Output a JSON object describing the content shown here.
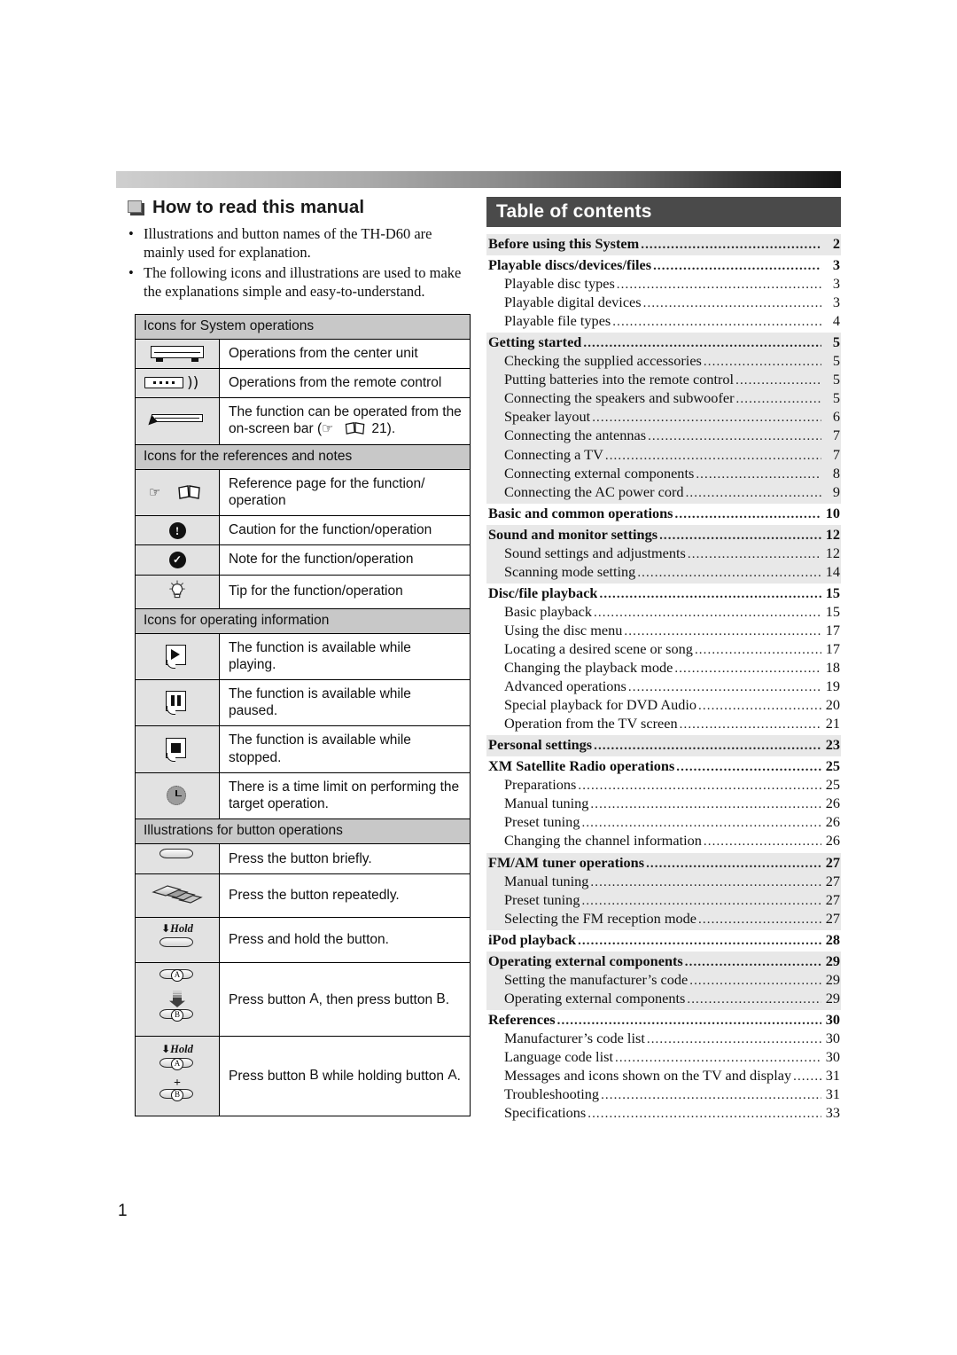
{
  "page": {
    "number": "1"
  },
  "left": {
    "heading": "How to read this manual",
    "bullets": [
      "Illustrations and button names of the TH-D60 are mainly used for explanation.",
      "The following icons and illustrations are used to make the explanations simple and easy-to-understand."
    ],
    "sections": [
      {
        "title": "Icons for System operations",
        "rows": [
          {
            "icon": "center-unit-icon",
            "text": "Operations from the center unit"
          },
          {
            "icon": "remote-control-icon",
            "text": "Operations from the remote control"
          },
          {
            "icon": "on-screen-bar-icon",
            "text": "The function can be operated from the on-screen bar (",
            "text_after": " 21).",
            "inline_ref_page": "21"
          }
        ]
      },
      {
        "title": "Icons for the references and notes",
        "rows": [
          {
            "icon": "reference-page-icon",
            "text": "Reference page for the function/ operation"
          },
          {
            "icon": "caution-icon",
            "text": "Caution for the function/operation"
          },
          {
            "icon": "note-icon",
            "text": "Note for the function/operation"
          },
          {
            "icon": "tip-bulb-icon",
            "text": "Tip for the function/operation"
          }
        ]
      },
      {
        "title": "Icons for operating information",
        "rows": [
          {
            "icon": "play-state-icon",
            "text": "The function is available while playing."
          },
          {
            "icon": "pause-state-icon",
            "text": "The function is available while paused."
          },
          {
            "icon": "stop-state-icon",
            "text": "The function is available while stopped."
          },
          {
            "icon": "time-limit-clock-icon",
            "text": "There is a time limit on performing the target operation."
          }
        ]
      },
      {
        "title": "Illustrations for button operations",
        "rows": [
          {
            "icon": "press-briefly-icon",
            "text": "Press the button briefly."
          },
          {
            "icon": "press-repeatedly-icon",
            "text": "Press the button repeatedly."
          },
          {
            "icon": "press-and-hold-icon",
            "hold_label": "Hold",
            "text": "Press and hold the button."
          },
          {
            "icon": "press-a-then-b-icon",
            "button_a": "A",
            "button_b": "B",
            "text_parts": [
              "Press button ",
              ", then press button ",
              "."
            ]
          },
          {
            "icon": "press-b-while-holding-a-icon",
            "hold_label": "Hold",
            "button_a": "A",
            "button_b": "B",
            "plus": "+",
            "text_parts": [
              "Press button ",
              " while holding button ",
              "."
            ]
          }
        ]
      }
    ]
  },
  "toc": {
    "title": "Table of contents",
    "groups": [
      {
        "shaded": true,
        "entries": [
          {
            "level": "major",
            "text": "Before using this System",
            "page": "2"
          }
        ]
      },
      {
        "shaded": false,
        "entries": [
          {
            "level": "major",
            "text": "Playable discs/devices/files",
            "page": "3"
          },
          {
            "level": "sub",
            "text": "Playable disc types",
            "page": "3"
          },
          {
            "level": "sub",
            "text": "Playable digital devices",
            "page": "3"
          },
          {
            "level": "sub",
            "text": "Playable file types",
            "page": "4"
          }
        ]
      },
      {
        "shaded": true,
        "entries": [
          {
            "level": "major",
            "text": "Getting started",
            "page": "5"
          },
          {
            "level": "sub",
            "text": "Checking the supplied accessories",
            "page": "5"
          },
          {
            "level": "sub",
            "text": "Putting batteries into the remote control",
            "page": "5"
          },
          {
            "level": "sub",
            "text": "Connecting the speakers and subwoofer",
            "page": "5"
          },
          {
            "level": "sub",
            "text": "Speaker layout",
            "page": "6"
          },
          {
            "level": "sub",
            "text": "Connecting the antennas",
            "page": "7"
          },
          {
            "level": "sub",
            "text": "Connecting a TV",
            "page": "7"
          },
          {
            "level": "sub",
            "text": "Connecting external components",
            "page": "8"
          },
          {
            "level": "sub",
            "text": "Connecting the AC power cord",
            "page": "9"
          }
        ]
      },
      {
        "shaded": false,
        "entries": [
          {
            "level": "major",
            "text": "Basic and common operations",
            "page": "10"
          }
        ]
      },
      {
        "shaded": true,
        "entries": [
          {
            "level": "major",
            "text": "Sound and monitor settings",
            "page": "12"
          },
          {
            "level": "sub",
            "text": "Sound settings and adjustments",
            "page": "12"
          },
          {
            "level": "sub",
            "text": "Scanning mode setting",
            "page": "14"
          }
        ]
      },
      {
        "shaded": false,
        "entries": [
          {
            "level": "major",
            "text": "Disc/file playback",
            "page": "15"
          },
          {
            "level": "sub",
            "text": "Basic playback",
            "page": "15"
          },
          {
            "level": "sub",
            "text": "Using the disc menu",
            "page": "17"
          },
          {
            "level": "sub",
            "text": "Locating a desired scene or song",
            "page": "17"
          },
          {
            "level": "sub",
            "text": "Changing the playback mode",
            "page": "18"
          },
          {
            "level": "sub",
            "text": "Advanced operations",
            "page": "19"
          },
          {
            "level": "sub",
            "text": "Special playback for DVD Audio",
            "page": "20"
          },
          {
            "level": "sub",
            "text": "Operation from the TV screen",
            "page": "21"
          }
        ]
      },
      {
        "shaded": true,
        "entries": [
          {
            "level": "major",
            "text": "Personal settings",
            "page": "23"
          }
        ]
      },
      {
        "shaded": false,
        "entries": [
          {
            "level": "major",
            "text": "XM Satellite Radio operations",
            "page": "25"
          },
          {
            "level": "sub",
            "text": "Preparations",
            "page": "25"
          },
          {
            "level": "sub",
            "text": "Manual tuning",
            "page": "26"
          },
          {
            "level": "sub",
            "text": "Preset tuning",
            "page": "26"
          },
          {
            "level": "sub",
            "text": "Changing the channel information",
            "page": "26"
          }
        ]
      },
      {
        "shaded": true,
        "entries": [
          {
            "level": "major",
            "text": "FM/AM tuner operations",
            "page": "27"
          },
          {
            "level": "sub",
            "text": "Manual tuning",
            "page": "27"
          },
          {
            "level": "sub",
            "text": "Preset tuning",
            "page": "27"
          },
          {
            "level": "sub",
            "text": "Selecting the FM reception mode",
            "page": "27"
          }
        ]
      },
      {
        "shaded": false,
        "entries": [
          {
            "level": "major",
            "text": "iPod playback",
            "page": "28"
          }
        ]
      },
      {
        "shaded": true,
        "entries": [
          {
            "level": "major",
            "text": "Operating external components",
            "page": "29"
          },
          {
            "level": "sub",
            "text": "Setting the manufacturer’s code",
            "page": "29"
          },
          {
            "level": "sub",
            "text": "Operating external components",
            "page": "29"
          }
        ]
      },
      {
        "shaded": false,
        "entries": [
          {
            "level": "major",
            "text": "References",
            "page": "30"
          },
          {
            "level": "sub",
            "text": "Manufacturer’s code list",
            "page": "30"
          },
          {
            "level": "sub",
            "text": "Language code list",
            "page": "30"
          },
          {
            "level": "sub",
            "text": "Messages and icons shown on the TV and display",
            "page": "31"
          },
          {
            "level": "sub",
            "text": "Troubleshooting",
            "page": "31"
          },
          {
            "level": "sub",
            "text": "Specifications",
            "page": "33"
          }
        ]
      }
    ]
  }
}
